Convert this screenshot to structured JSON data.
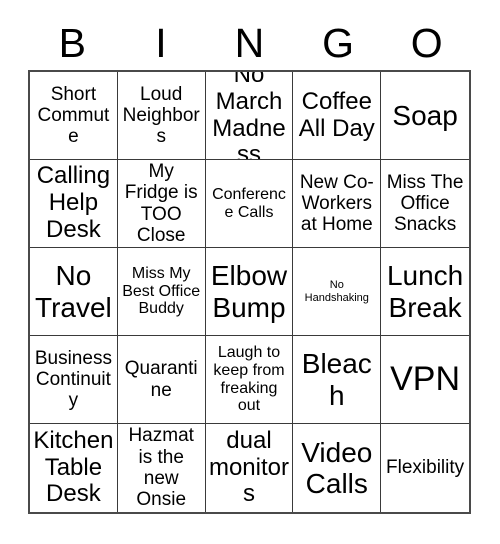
{
  "header": {
    "letters": [
      "B",
      "I",
      "N",
      "G",
      "O"
    ]
  },
  "grid": {
    "columns": 5,
    "rows": 5,
    "cells": [
      {
        "text": "Short Commute",
        "size": "md"
      },
      {
        "text": "Loud Neighbors",
        "size": "md"
      },
      {
        "text": "No March Madness",
        "size": "lg"
      },
      {
        "text": "Coffee All Day",
        "size": "lg"
      },
      {
        "text": "Soap",
        "size": "xl"
      },
      {
        "text": "Calling Help Desk",
        "size": "lg"
      },
      {
        "text": "My Fridge is TOO Close",
        "size": "md"
      },
      {
        "text": "Conference Calls",
        "size": "sm"
      },
      {
        "text": "New Co-Workers at Home",
        "size": "md"
      },
      {
        "text": "Miss The Office Snacks",
        "size": "md"
      },
      {
        "text": "No Travel",
        "size": "xl"
      },
      {
        "text": "Miss My Best Office Buddy",
        "size": "sm"
      },
      {
        "text": "Elbow Bump",
        "size": "xl"
      },
      {
        "text": "No Handshaking",
        "size": "xxs"
      },
      {
        "text": "Lunch Break",
        "size": "xl"
      },
      {
        "text": "Business Continuity",
        "size": "md"
      },
      {
        "text": "Quarantine",
        "size": "md"
      },
      {
        "text": "Laugh to keep from freaking out",
        "size": "sm"
      },
      {
        "text": "Bleach",
        "size": "xl"
      },
      {
        "text": "VPN",
        "size": "xxl"
      },
      {
        "text": "Kitchen Table Desk",
        "size": "lg"
      },
      {
        "text": "Hazmat is the new Onsie",
        "size": "md"
      },
      {
        "text": "dual monitors",
        "size": "lg"
      },
      {
        "text": "Video Calls",
        "size": "xl"
      },
      {
        "text": "Flexibility",
        "size": "md"
      }
    ]
  },
  "colors": {
    "background": "#ffffff",
    "text": "#000000",
    "outer_border": "#4a4a4a",
    "inner_border": "#3a3a3a"
  }
}
